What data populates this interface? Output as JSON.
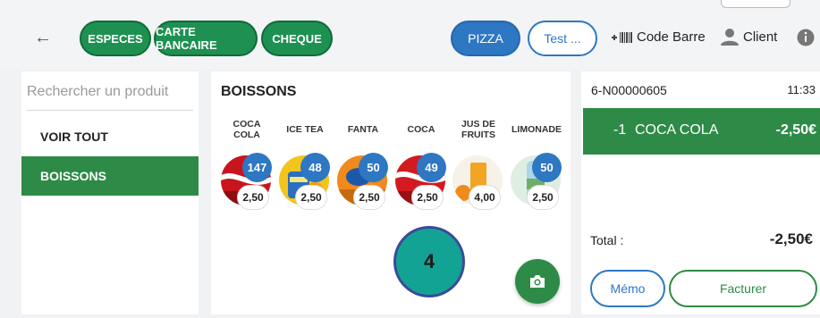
{
  "header": {
    "back_icon": "arrow-left-icon",
    "payment_methods": [
      "ESPECES",
      "CARTE BANCAIRE",
      "CHEQUE"
    ],
    "categories": [
      {
        "label": "PIZZA",
        "active": true
      },
      {
        "label": "Test ...",
        "active": false
      }
    ],
    "barcode_label": "Code Barre",
    "barcode_icon": "barcode-icon",
    "client_label": "Client",
    "client_icon": "person-icon",
    "info_icon": "info-icon"
  },
  "sidebar": {
    "search_placeholder": "Rechercher un produit",
    "items": [
      {
        "label": "VOIR TOUT",
        "active": false
      },
      {
        "label": "BOISSONS",
        "active": true
      }
    ]
  },
  "products": {
    "title": "BOISSONS",
    "items": [
      {
        "name": "COCA COLA",
        "stock": "147",
        "price": "2,50",
        "image_icon": "coca-cola-can-icon"
      },
      {
        "name": "ICE TEA",
        "stock": "48",
        "price": "2,50",
        "image_icon": "lipton-ice-tea-icon"
      },
      {
        "name": "FANTA",
        "stock": "50",
        "price": "2,50",
        "image_icon": "fanta-can-icon"
      },
      {
        "name": "COCA",
        "stock": "49",
        "price": "2,50",
        "image_icon": "coca-cola-can-icon"
      },
      {
        "name": "JUS DE FRUITS",
        "stock": "",
        "price": "4,00",
        "image_icon": "orange-juice-icon"
      },
      {
        "name": "LIMONADE",
        "stock": "50",
        "price": "2,50",
        "image_icon": "lemonade-bottle-icon"
      }
    ],
    "camera_icon": "camera-icon"
  },
  "marker": {
    "label": "4"
  },
  "order": {
    "id": "6-N00000605",
    "time": "11:33",
    "lines": [
      {
        "qty": "-1",
        "name": "COCA COLA",
        "price": "-2,50€"
      }
    ],
    "total_label": "Total :",
    "total_value": "-2,50€",
    "memo_label": "Mémo",
    "invoice_label": "Facturer"
  },
  "colors": {
    "green": "#2e8b47",
    "blue": "#2e77c2",
    "teal_marker": "#13a394",
    "background": "#f1f2f4"
  }
}
